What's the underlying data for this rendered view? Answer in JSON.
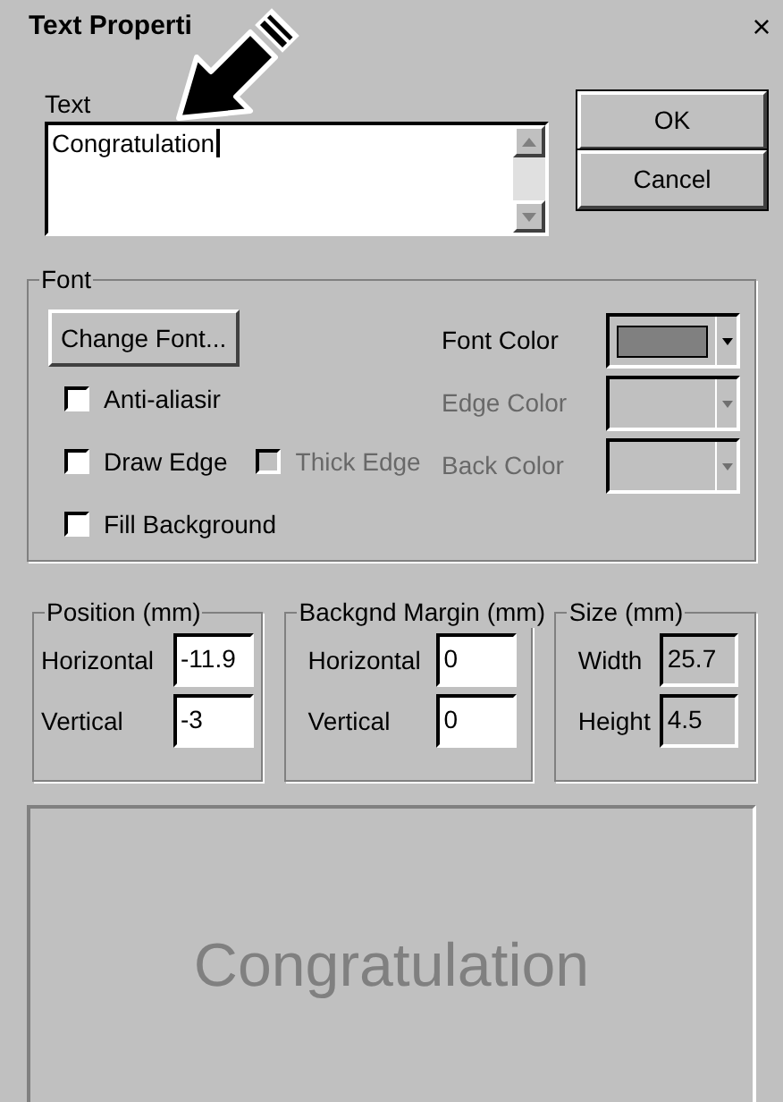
{
  "window": {
    "title": "Text Properti",
    "close": "×"
  },
  "text_field": {
    "label": "Text",
    "value": "Congratulation"
  },
  "buttons": [
    {
      "label": "OK"
    },
    {
      "label": "Cancel"
    }
  ],
  "font": {
    "title": "Font",
    "change_button": "Change Font...",
    "colors": [
      {
        "label": "Font Color",
        "disabled": false,
        "color": "#808080"
      },
      {
        "label": "Edge Color",
        "disabled": true
      },
      {
        "label": "Back Color",
        "disabled": true
      }
    ],
    "options": [
      {
        "label": "Anti-aliasir",
        "checked": false,
        "disabled": false
      },
      {
        "label": "Draw Edge",
        "checked": false,
        "disabled": false
      },
      {
        "label": "Thick Edge",
        "checked": false,
        "disabled": true
      },
      {
        "label": "Fill Background",
        "checked": false,
        "disabled": false
      }
    ]
  },
  "groups": [
    {
      "title": "Position (mm)",
      "fields": [
        {
          "label": "Horizontal",
          "value": "-11.9",
          "readonly": false
        },
        {
          "label": "Vertical",
          "value": "-3",
          "readonly": false
        }
      ]
    },
    {
      "title": "Backgnd Margin (mm)",
      "fields": [
        {
          "label": "Horizontal",
          "value": "0",
          "readonly": false
        },
        {
          "label": "Vertical",
          "value": "0",
          "readonly": false
        }
      ]
    },
    {
      "title": "Size (mm)",
      "fields": [
        {
          "label": "Width",
          "value": "25.7",
          "readonly": true
        },
        {
          "label": "Height",
          "value": "4.5",
          "readonly": true
        }
      ]
    }
  ],
  "preview": {
    "text": "Congratulation"
  }
}
